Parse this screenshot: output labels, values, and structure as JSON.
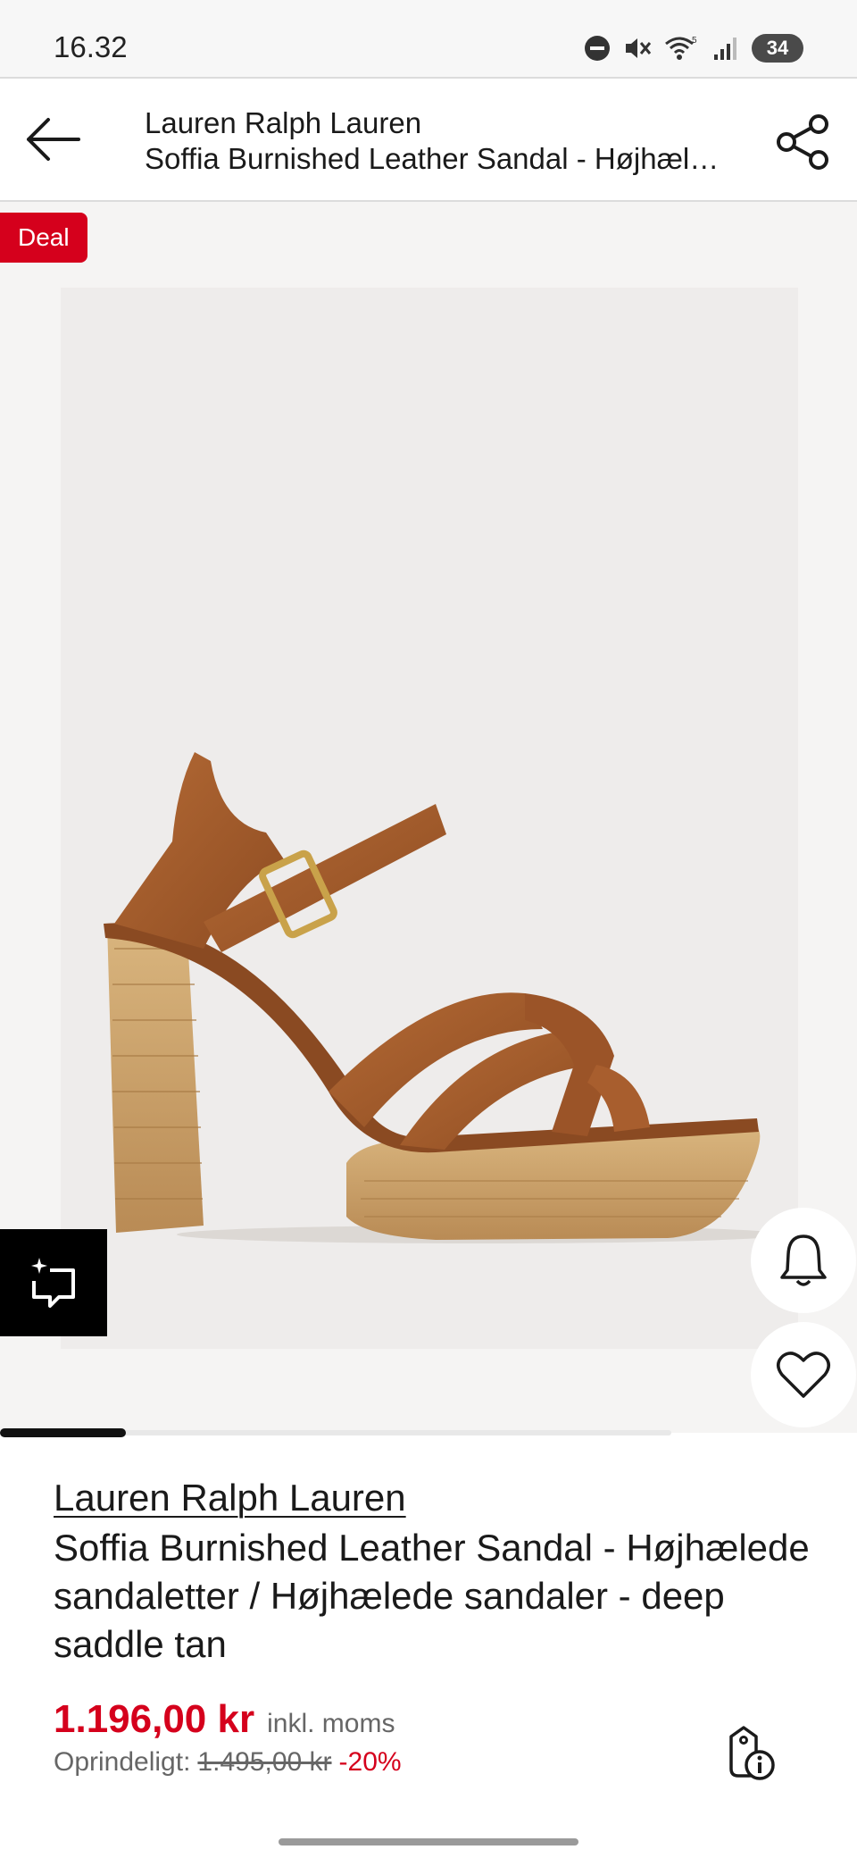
{
  "status_bar": {
    "time": "16.32",
    "battery": "34",
    "icons": [
      "do-not-disturb-icon",
      "mute-icon",
      "wifi-icon",
      "signal-icon",
      "battery-icon"
    ]
  },
  "header": {
    "brand": "Lauren Ralph Lauren",
    "product_title": "Soffia Burnished Leather Sandal - Højhælede sandaletter / Højhælede sandaler - deep saddle tan",
    "back_icon": "arrow-left-icon",
    "share_icon": "share-icon"
  },
  "gallery": {
    "badge": "Deal",
    "image_alt": "Lauren Ralph Lauren Soffia Burnished Leather Sandal, deep saddle tan",
    "image_index": 1,
    "image_count": 8,
    "ai_icon": "ai-chat-icon",
    "bell_icon": "bell-icon",
    "heart_icon": "heart-icon"
  },
  "product": {
    "brand": "Lauren Ralph Lauren",
    "name": "Soffia Burnished Leather Sandal - Højhælede sandaletter / Højhælede sandaler - deep saddle tan"
  },
  "price": {
    "current": "1.196,00 kr",
    "vat_note": "inkl. moms",
    "original_label": "Oprindeligt:",
    "original": "1.495,00 kr",
    "discount": "-20%",
    "info_icon": "price-tag-info-icon"
  },
  "colors": {
    "accent": "#d5001c",
    "text": "#1a1a1a",
    "muted": "#666666",
    "leather": "#a65e2e",
    "wood": "#c9a36b"
  }
}
